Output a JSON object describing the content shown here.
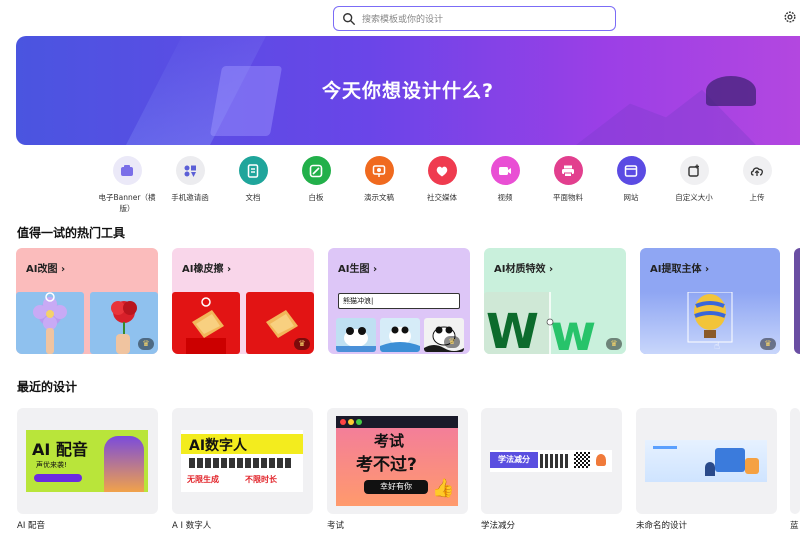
{
  "search": {
    "placeholder": "搜索模板或你的设计"
  },
  "hero": {
    "title": "今天你想设计什么?"
  },
  "tools": [
    {
      "label": "电子Banner（横版）",
      "icon": "banner-icon",
      "color": "#7a6ee8",
      "bg": "#ebe9f8"
    },
    {
      "label": "手机邀请函",
      "icon": "invitation-icon",
      "color": "#5b5fd6",
      "bg": "#ececef"
    },
    {
      "label": "文档",
      "icon": "document-icon",
      "color": "#ffffff",
      "bg": "#1fa59b"
    },
    {
      "label": "白板",
      "icon": "whiteboard-icon",
      "color": "#ffffff",
      "bg": "#22b04a"
    },
    {
      "label": "演示文稿",
      "icon": "presentation-icon",
      "color": "#ffffff",
      "bg": "#f06a1f"
    },
    {
      "label": "社交媒体",
      "icon": "heart-icon",
      "color": "#ffffff",
      "bg": "#ef3b4f"
    },
    {
      "label": "视频",
      "icon": "video-icon",
      "color": "#ffffff",
      "bg": "#e94fd4"
    },
    {
      "label": "平面物料",
      "icon": "print-icon",
      "color": "#ffffff",
      "bg": "#e23f8e"
    },
    {
      "label": "网站",
      "icon": "website-icon",
      "color": "#ffffff",
      "bg": "#5b4be3"
    },
    {
      "label": "自定义大小",
      "icon": "custom-size-icon",
      "color": "#333333",
      "bg": "#f0f0f2"
    },
    {
      "label": "上传",
      "icon": "upload-icon",
      "color": "#333333",
      "bg": "#f0f0f2"
    }
  ],
  "hot_section": {
    "title": "值得一试的热门工具"
  },
  "hot_tools": [
    {
      "label": "AI改图",
      "bg": "#fbbcbc"
    },
    {
      "label": "AI橡皮擦",
      "bg": "#f9d6ea"
    },
    {
      "label": "AI生图",
      "bg": "#ddc6f7",
      "prompt": "熊猫冲浪"
    },
    {
      "label": "AI材质特效",
      "bg": "#c9f0dc"
    },
    {
      "label": "AI提取主体",
      "bg": "#8fa6f3"
    }
  ],
  "recent_section": {
    "title": "最近的设计"
  },
  "recent": [
    {
      "label": "AI 配音",
      "banner_text": "AI 配音",
      "sub": "声优来袭!"
    },
    {
      "label": "A I 数字人",
      "banner_text": "AI数字人",
      "sub1": "无限生成",
      "sub2": "不限时长"
    },
    {
      "label": "考试",
      "line1": "考试",
      "line2": "考不过?",
      "line3": "幸好有你"
    },
    {
      "label": "学法减分",
      "banner_text": "学法减分"
    },
    {
      "label": "未命名的设计"
    },
    {
      "label": "蓝"
    }
  ]
}
